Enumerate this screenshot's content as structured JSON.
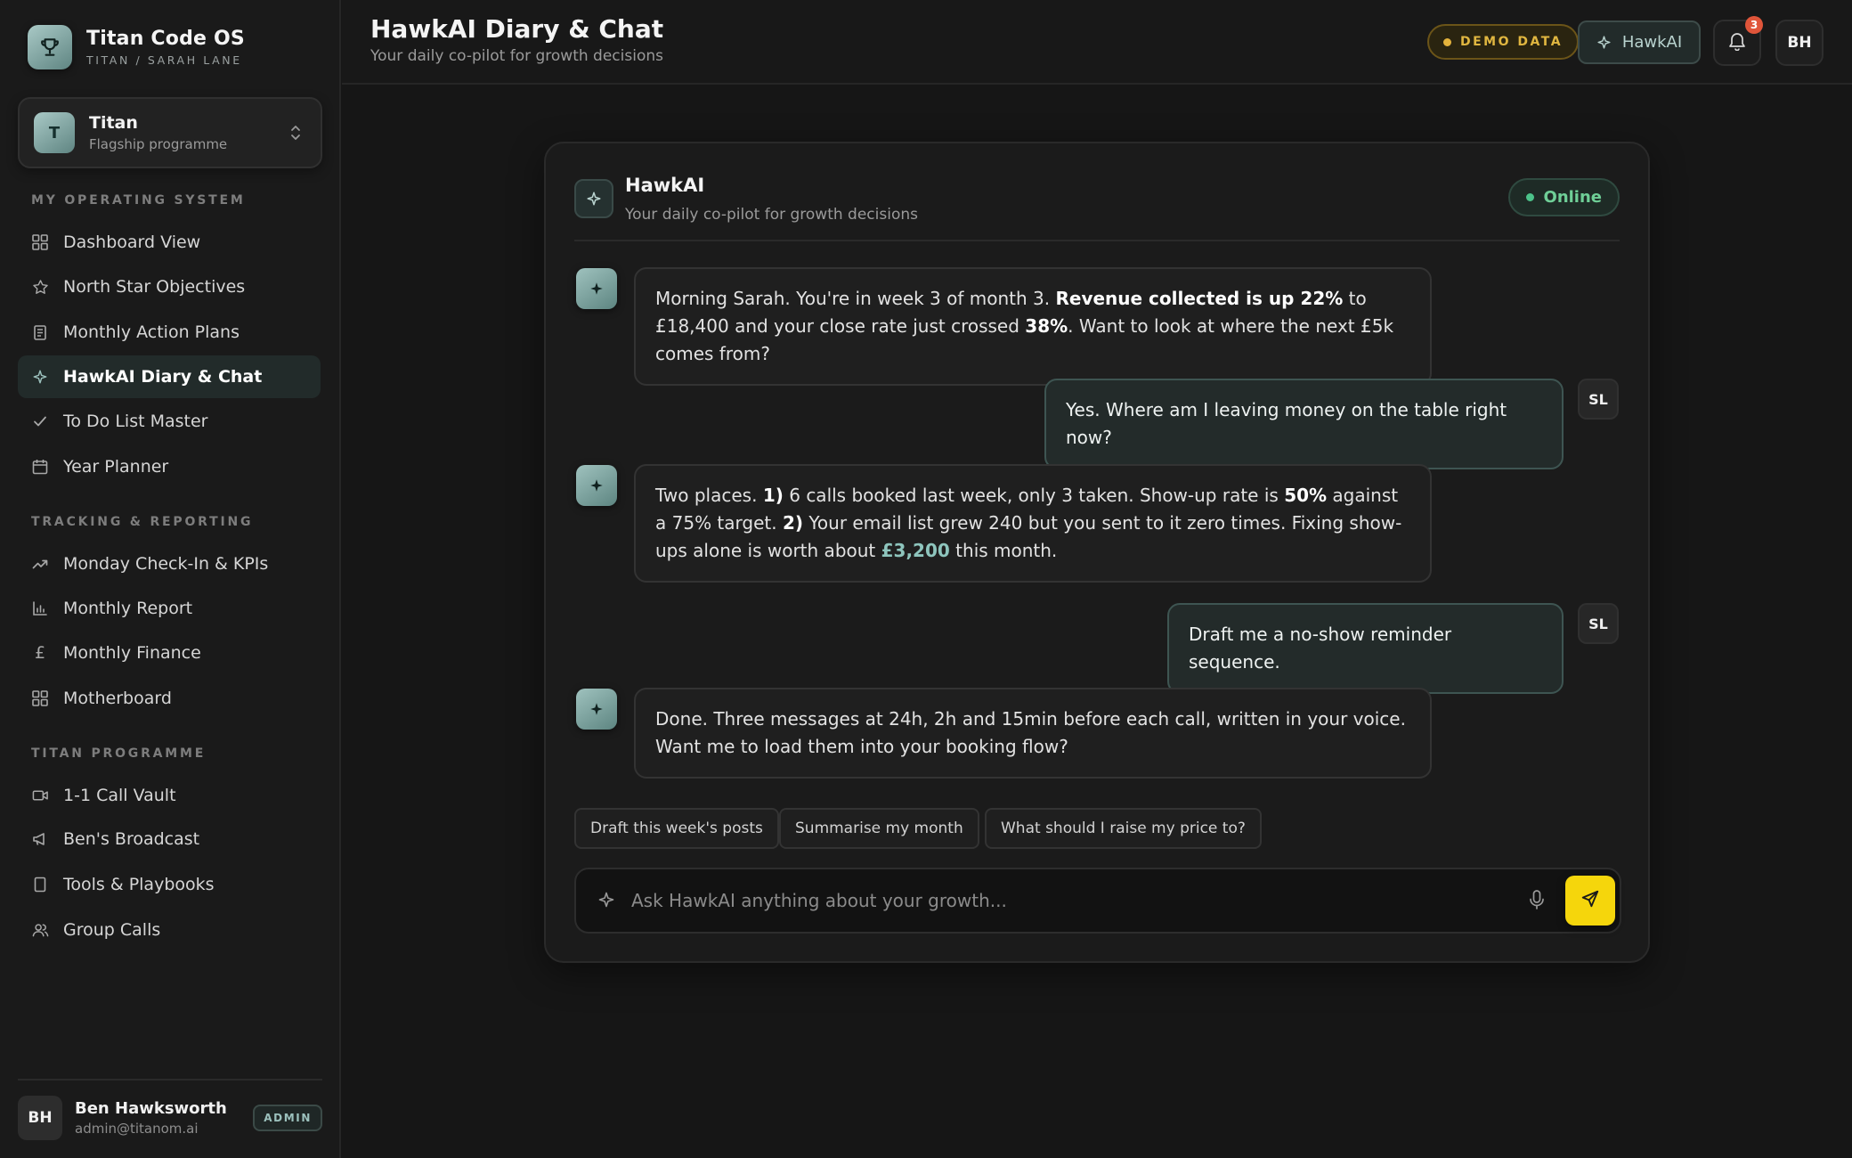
{
  "brand": {
    "title": "Titan Code OS",
    "subtitle": "TITAN / SARAH LANE",
    "icon": "trophy-icon"
  },
  "programme": {
    "initial": "T",
    "name": "Titan",
    "description": "Flagship programme"
  },
  "sidebar": {
    "sections": [
      {
        "label": "MY OPERATING SYSTEM",
        "items": [
          {
            "label": "Dashboard View",
            "icon": "grid-icon"
          },
          {
            "label": "North Star Objectives",
            "icon": "star-icon"
          },
          {
            "label": "Monthly Action Plans",
            "icon": "clipboard-icon"
          },
          {
            "label": "HawkAI Diary & Chat",
            "icon": "sparkle-icon",
            "active": true
          },
          {
            "label": "To Do List Master",
            "icon": "check-icon"
          },
          {
            "label": "Year Planner",
            "icon": "calendar-icon"
          }
        ]
      },
      {
        "label": "TRACKING & REPORTING",
        "items": [
          {
            "label": "Monday Check-In & KPIs",
            "icon": "trend-icon"
          },
          {
            "label": "Monthly Report",
            "icon": "bar-chart-icon"
          },
          {
            "label": "Monthly Finance",
            "icon": "pound-icon"
          },
          {
            "label": "Motherboard",
            "icon": "grid-icon"
          }
        ]
      },
      {
        "label": "TITAN PROGRAMME",
        "items": [
          {
            "label": "1-1 Call Vault",
            "icon": "video-icon"
          },
          {
            "label": "Ben's Broadcast",
            "icon": "megaphone-icon"
          },
          {
            "label": "Tools & Playbooks",
            "icon": "book-icon"
          },
          {
            "label": "Group Calls",
            "icon": "users-icon"
          }
        ]
      }
    ]
  },
  "user": {
    "initials": "BH",
    "name": "Ben Hawksworth",
    "email": "admin@titanom.ai",
    "role": "ADMIN"
  },
  "header": {
    "title": "HawkAI Diary & Chat",
    "subtitle": "Your daily co-pilot for growth decisions",
    "demo_label": "DEMO DATA",
    "hawk_button": "HawkAI",
    "notifications": "3",
    "avatar": "BH"
  },
  "chat": {
    "name": "HawkAI",
    "description": "Your daily co-pilot for growth decisions",
    "status": "Online",
    "user_initials": "SL",
    "messages": [
      {
        "from": "bot",
        "parts": [
          "Morning Sarah. You're in week 3 of month 3. ",
          "Revenue collected is up 22%",
          " to £18,400 and your close rate just crossed ",
          "38%",
          ". Want to look at where the next £5k comes from?"
        ]
      },
      {
        "from": "user",
        "text": "Yes. Where am I leaving money on the table right now?"
      },
      {
        "from": "bot",
        "parts": [
          "Two places. ",
          "1)",
          " 6 calls booked last week, only 3 taken. Show-up rate is ",
          "50%",
          " against a 75% target. ",
          "2)",
          " Your email list grew 240 but you sent to it zero times. Fixing show-ups alone is worth about ",
          "£3,200",
          " this month."
        ]
      },
      {
        "from": "user",
        "text": "Draft me a no-show reminder sequence."
      },
      {
        "from": "bot",
        "parts": [
          "Done. Three messages at 24h, 2h and 15min before each call, written in your voice. Want me to load them into your booking flow?"
        ]
      }
    ],
    "suggestions": [
      "Draft this week's posts",
      "Summarise my month",
      "What should I raise my price to?"
    ],
    "input_placeholder": "Ask HawkAI anything about your growth..."
  },
  "colors": {
    "accent": "#8ec5bd",
    "send": "#f5d60c",
    "online": "#4cc38a",
    "demo": "#e3b23c",
    "notification": "#e0553a"
  }
}
